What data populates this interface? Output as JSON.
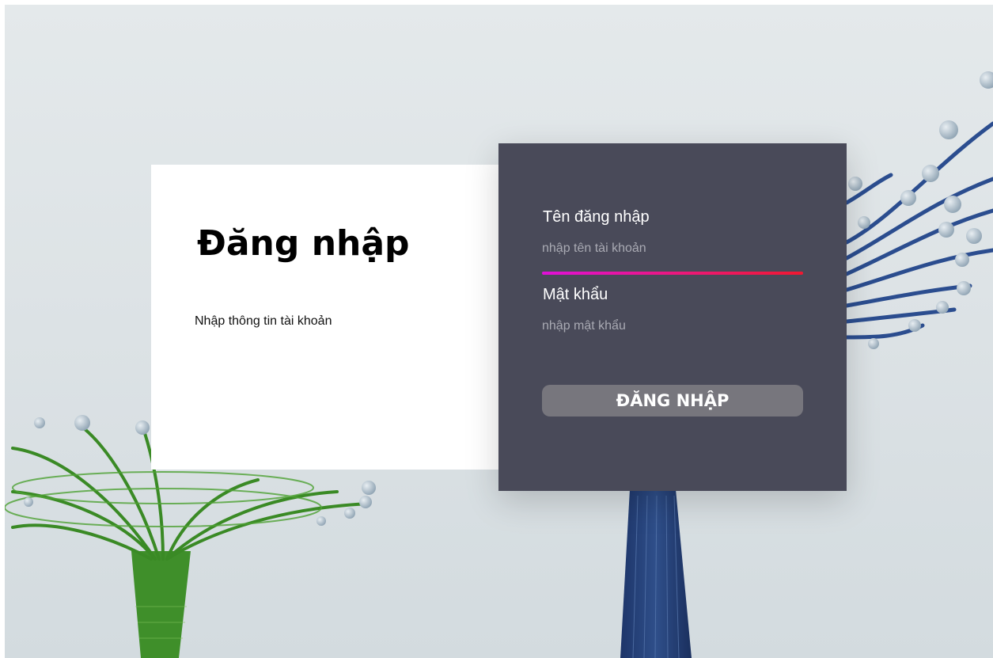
{
  "login": {
    "title": "Đăng nhập",
    "subtitle": "Nhập thông tin tài khoản",
    "username": {
      "label": "Tên đăng nhập",
      "placeholder": "nhập tên tài khoản",
      "value": ""
    },
    "password": {
      "label": "Mật khẩu",
      "placeholder": "nhập mật khẩu",
      "value": ""
    },
    "submit_label": "ĐĂNG NHẬP"
  },
  "colors": {
    "panel": "#494a59",
    "card": "#ffffff",
    "button": "#77767d",
    "focus_start": "#e010d8",
    "focus_end": "#f01830"
  }
}
